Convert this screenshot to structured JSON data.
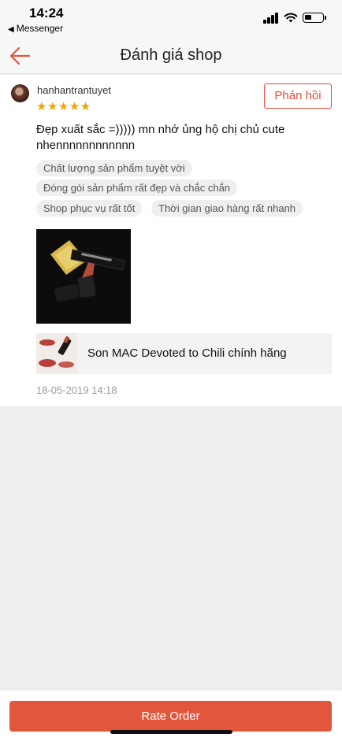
{
  "status_bar": {
    "time": "14:24",
    "back_app_label": "Messenger"
  },
  "nav": {
    "title": "Đánh giá shop",
    "back_icon": "arrow-left-icon"
  },
  "review": {
    "username": "hanhantrantuyet",
    "rating": 5,
    "stars": "★★★★★",
    "reply_label": "Phản hồi",
    "comment": "Đẹp xuất sắc =))))) mn nhớ ủng hộ chị chủ cute nhennnnnnnnnnnn",
    "tags": [
      "Chất lượng sản phẩm tuyệt vời",
      "Đóng gói sản phẩm rất đẹp và chắc chắn",
      "Shop phục vụ rất tốt",
      "Thời gian giao hàng rất nhanh"
    ],
    "product_name": "Son MAC Devoted to Chili chính hãng",
    "date": "18-05-2019 14:18"
  },
  "footer": {
    "rate_label": "Rate Order"
  },
  "colors": {
    "accent": "#e2563d",
    "star": "#f0a500"
  }
}
